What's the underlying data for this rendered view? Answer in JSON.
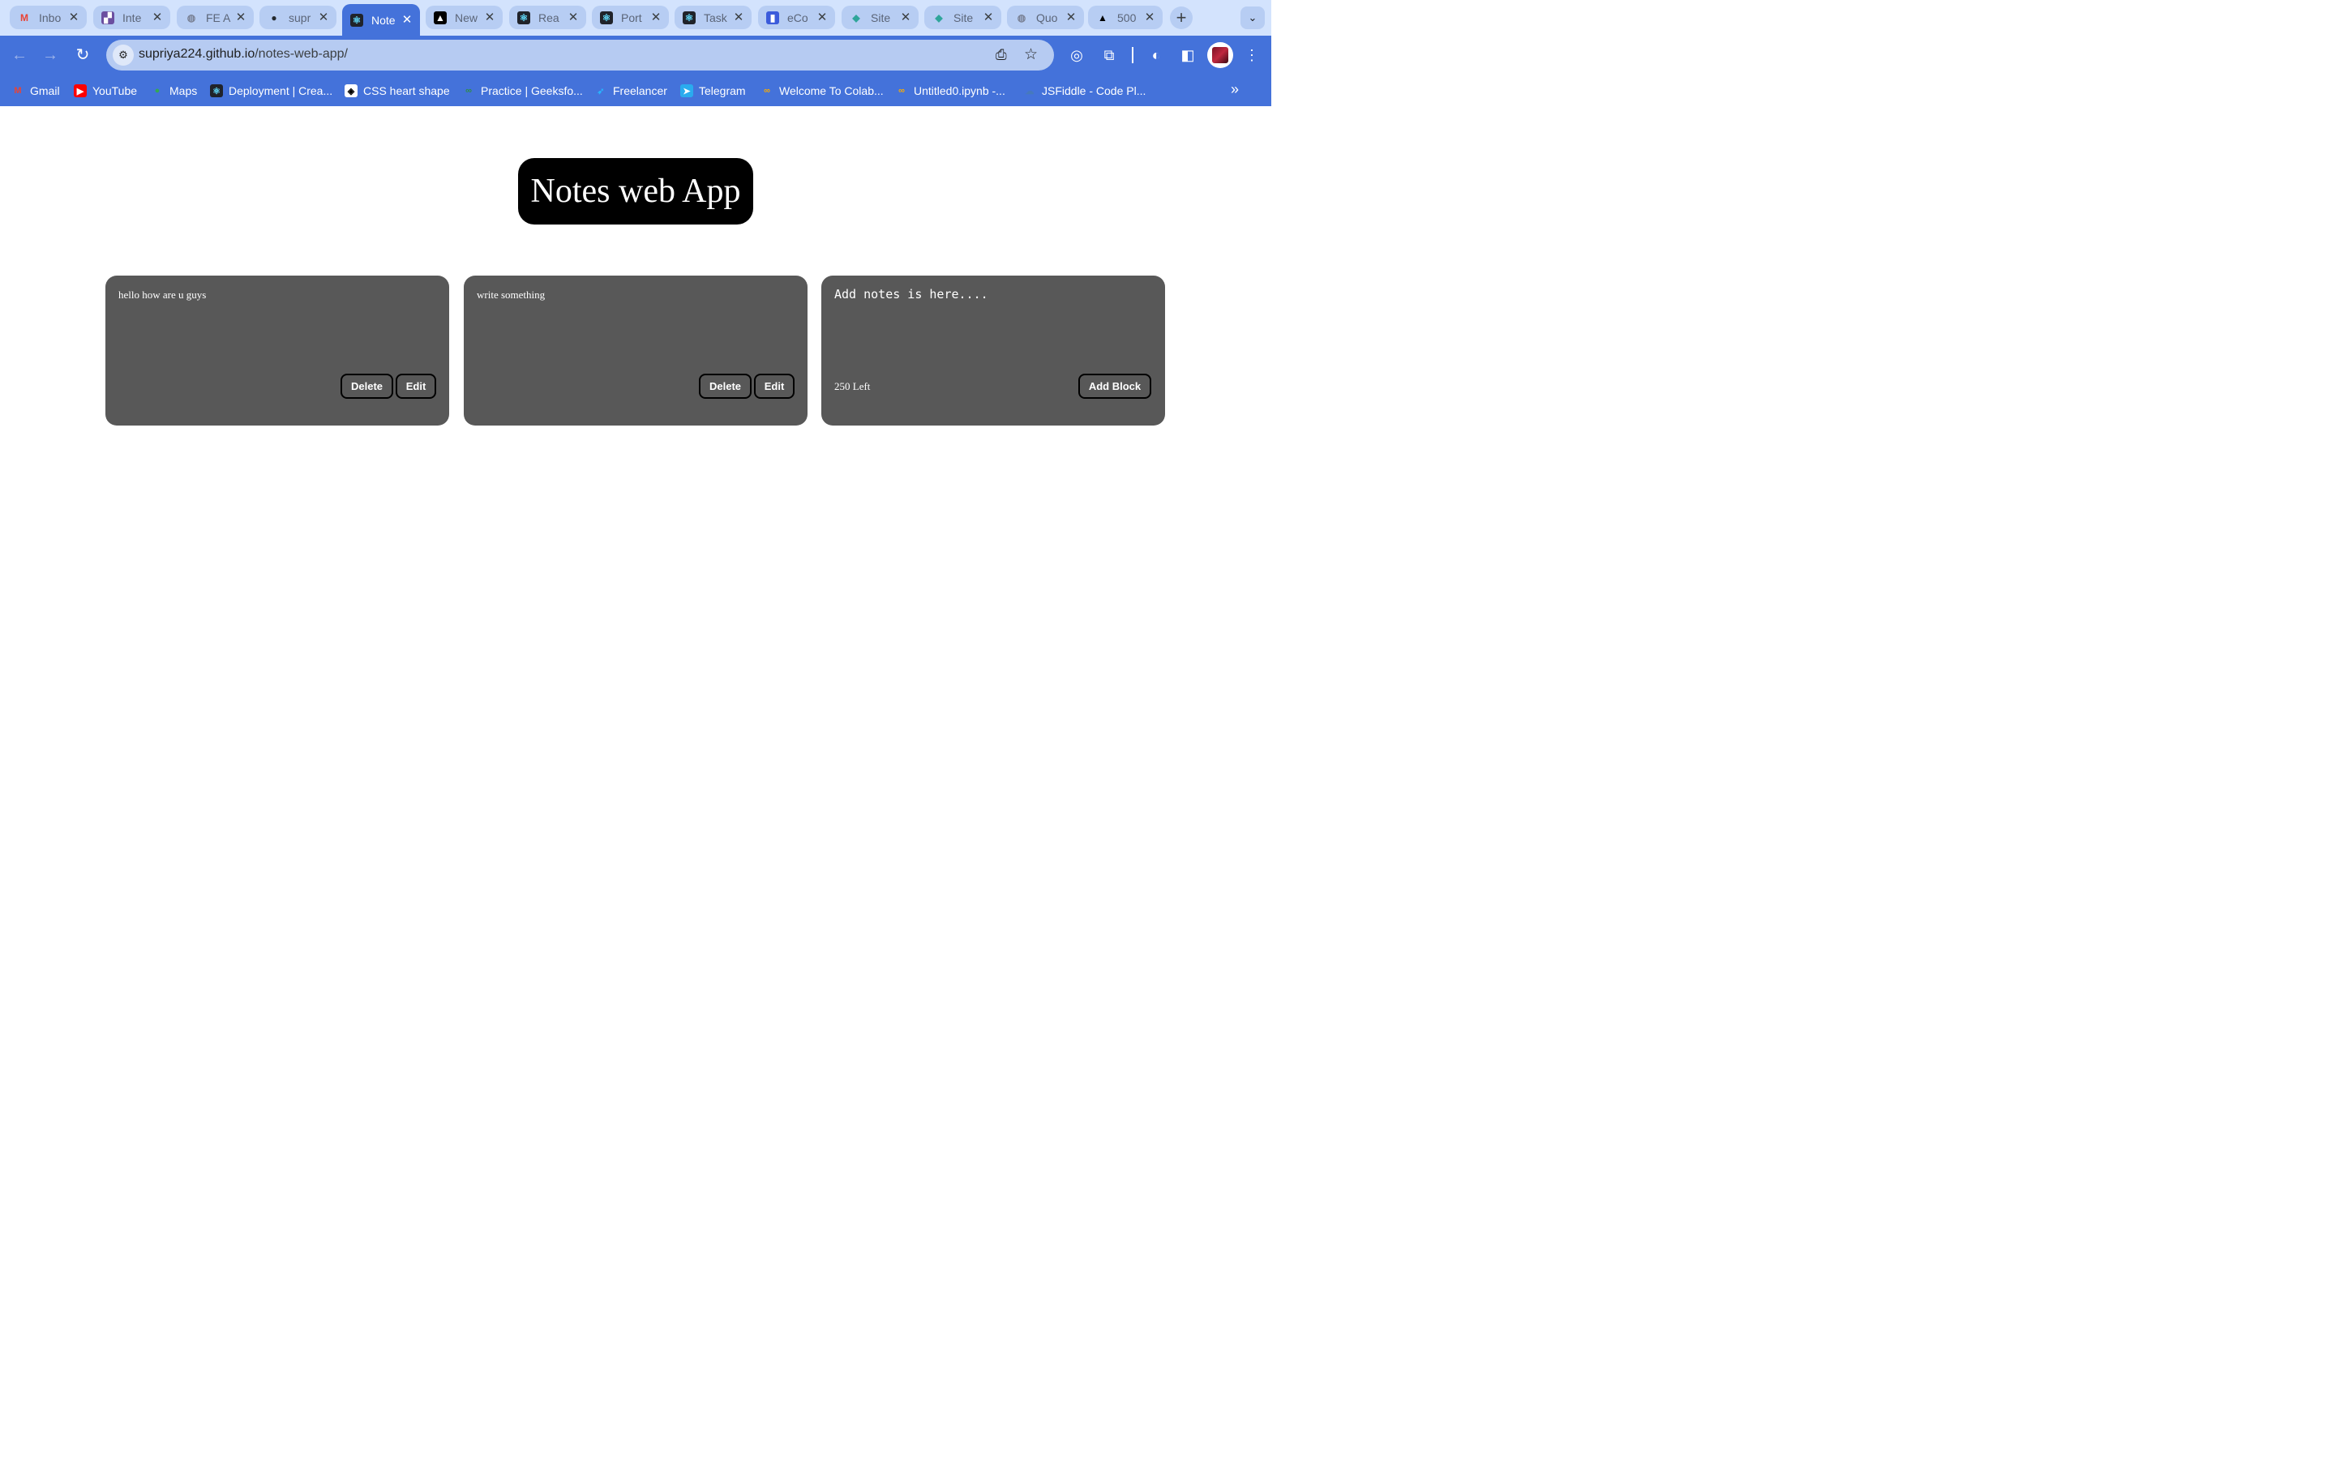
{
  "browser": {
    "tabs": [
      {
        "title": "Inbo",
        "icon": "gmail-icon",
        "icon_glyph": "M",
        "icon_color": "#ea4335",
        "icon_bg": "transparent"
      },
      {
        "title": "Inte",
        "icon": "project-icon",
        "icon_glyph": "▞",
        "icon_color": "#ffffff",
        "icon_bg": "#6b4fa0"
      },
      {
        "title": "FE A",
        "icon": "globe-icon",
        "icon_glyph": "◍",
        "icon_color": "#7a8296",
        "icon_bg": "transparent"
      },
      {
        "title": "supr",
        "icon": "github-icon",
        "icon_glyph": "●",
        "icon_color": "#24292f",
        "icon_bg": "transparent"
      },
      {
        "title": "Note",
        "icon": "react-icon",
        "icon_glyph": "⚛",
        "icon_color": "#61dafb",
        "icon_bg": "#20232a",
        "active": true
      },
      {
        "title": "New",
        "icon": "vercel-icon",
        "icon_glyph": "▲",
        "icon_color": "#ffffff",
        "icon_bg": "#000000"
      },
      {
        "title": "Rea",
        "icon": "react-icon",
        "icon_glyph": "⚛",
        "icon_color": "#61dafb",
        "icon_bg": "#20232a"
      },
      {
        "title": "Port",
        "icon": "react-icon",
        "icon_glyph": "⚛",
        "icon_color": "#61dafb",
        "icon_bg": "#20232a"
      },
      {
        "title": "Task",
        "icon": "react-icon",
        "icon_glyph": "⚛",
        "icon_color": "#61dafb",
        "icon_bg": "#20232a"
      },
      {
        "title": "eCo",
        "icon": "chart-icon",
        "icon_glyph": "▮",
        "icon_color": "#ffffff",
        "icon_bg": "#3b5bdb"
      },
      {
        "title": "Site",
        "icon": "diamond-icon",
        "icon_glyph": "◆",
        "icon_color": "#2fa59a",
        "icon_bg": "transparent"
      },
      {
        "title": "Site",
        "icon": "diamond-icon",
        "icon_glyph": "◆",
        "icon_color": "#2fa59a",
        "icon_bg": "transparent"
      },
      {
        "title": "Quo",
        "icon": "globe-icon",
        "icon_glyph": "◍",
        "icon_color": "#7a8296",
        "icon_bg": "transparent"
      },
      {
        "title": "500",
        "icon": "vercel-icon",
        "icon_glyph": "▲",
        "icon_color": "#000000",
        "icon_bg": "transparent"
      }
    ],
    "new_tab_glyph": "+",
    "tab_search_glyph": "⌄",
    "close_glyph": "✕",
    "nav": {
      "back": "←",
      "forward": "→",
      "reload": "↻"
    },
    "address": {
      "host": "supriya224.github.io",
      "path": "/notes-web-app/"
    },
    "toolbar_icons": {
      "install": "⎙",
      "star": "☆",
      "tracking": "◎",
      "extensions": "⧉",
      "performance": "◐",
      "sidebar": "◧",
      "menu": "⋮"
    },
    "bookmarks": [
      {
        "label": "Gmail",
        "icon": "gmail-icon",
        "glyph": "M",
        "color": "#ea4335",
        "bg": "transparent"
      },
      {
        "label": "YouTube",
        "icon": "youtube-icon",
        "glyph": "▶",
        "color": "#ffffff",
        "bg": "#ff0000"
      },
      {
        "label": "Maps",
        "icon": "maps-icon",
        "glyph": "●",
        "color": "#34a853",
        "bg": "transparent"
      },
      {
        "label": "Deployment | Crea...",
        "icon": "react-icon",
        "glyph": "⚛",
        "color": "#61dafb",
        "bg": "#20232a"
      },
      {
        "label": "CSS heart shape",
        "icon": "codepen-icon",
        "glyph": "◈",
        "color": "#000000",
        "bg": "#ffffff"
      },
      {
        "label": "Practice | Geeksfo...",
        "icon": "geeksforgeeks-icon",
        "glyph": "∞",
        "color": "#2f8d46",
        "bg": "transparent"
      },
      {
        "label": "Freelancer",
        "icon": "freelancer-icon",
        "glyph": "➶",
        "color": "#29b2fe",
        "bg": "transparent"
      },
      {
        "label": "Telegram",
        "icon": "telegram-icon",
        "glyph": "➤",
        "color": "#ffffff",
        "bg": "#2aabee"
      },
      {
        "label": "Welcome To Colab...",
        "icon": "colab-icon",
        "glyph": "∞",
        "color": "#f9ab00",
        "bg": "transparent"
      },
      {
        "label": "Untitled0.ipynb -...",
        "icon": "colab-icon",
        "glyph": "∞",
        "color": "#f9ab00",
        "bg": "transparent"
      },
      {
        "label": "JSFiddle - Code Pl...",
        "icon": "jsfiddle-icon",
        "glyph": "☁",
        "color": "#4679bd",
        "bg": "transparent"
      }
    ],
    "bookmarks_more_glyph": "»"
  },
  "app": {
    "title": "Notes web App",
    "notes": [
      {
        "text": "hello how are u guys",
        "delete_label": "Delete",
        "edit_label": "Edit"
      },
      {
        "text": "write something",
        "delete_label": "Delete",
        "edit_label": "Edit"
      }
    ],
    "new_note": {
      "placeholder": "Add notes is here....",
      "value": "",
      "chars_left": "250 Left",
      "add_label": "Add Block"
    }
  }
}
